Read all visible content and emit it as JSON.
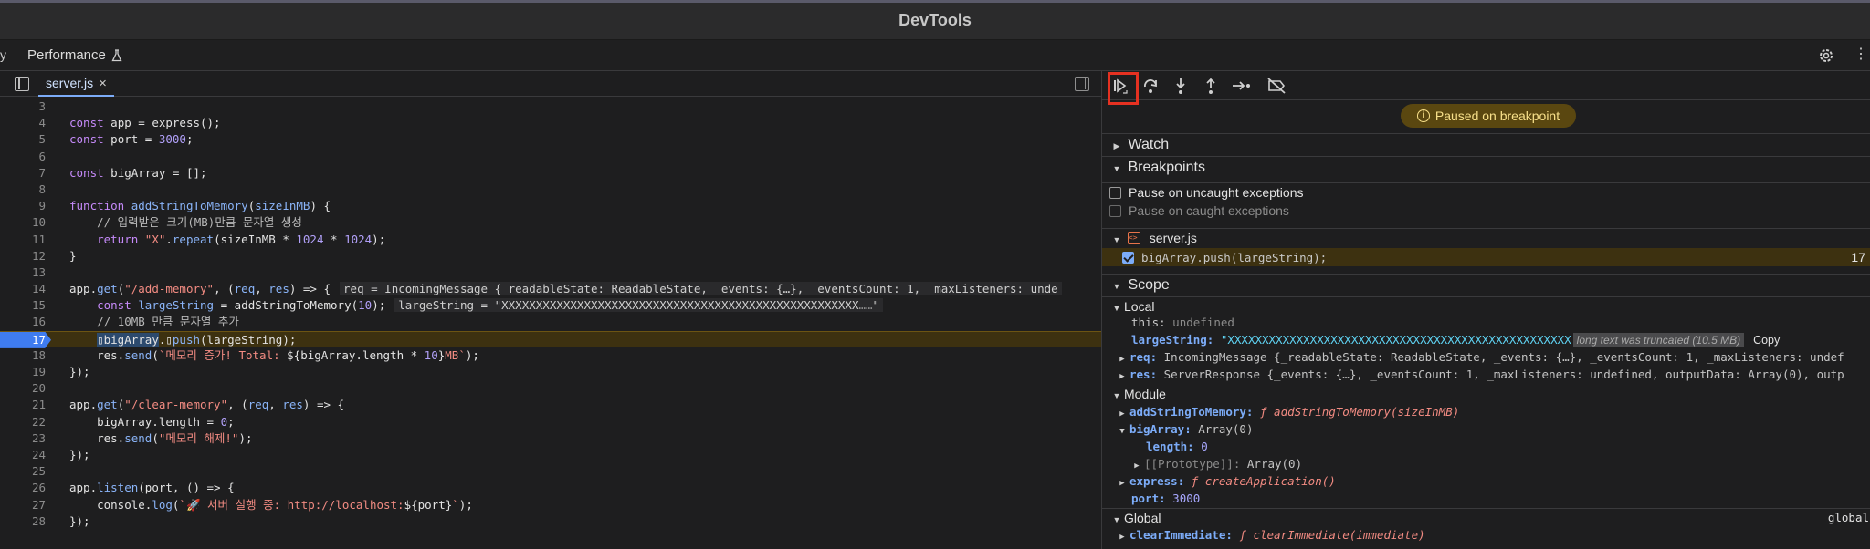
{
  "window": {
    "title": "DevTools"
  },
  "tabs": {
    "stub_label": "y",
    "performance_label": "Performance"
  },
  "editor": {
    "file_tab": "server.js",
    "close_glyph": "×",
    "lines": [
      {
        "n": "3",
        "html": ""
      },
      {
        "n": "4",
        "html": "<span class='kw'>const</span> app = express();"
      },
      {
        "n": "5",
        "html": "<span class='kw'>const</span> port = <span class='num'>3000</span>;"
      },
      {
        "n": "6",
        "html": ""
      },
      {
        "n": "7",
        "html": "<span class='kw'>const</span> bigArray = [];"
      },
      {
        "n": "8",
        "html": ""
      },
      {
        "n": "9",
        "html": "<span class='kw'>function</span> <span class='fn'>addStringToMemory</span>(<span class='fn'>sizeInMB</span>) {"
      },
      {
        "n": "10",
        "html": "    <span class='cm'>// 입력받은 크기(MB)만큼 문자열 생성</span>"
      },
      {
        "n": "11",
        "html": "    <span class='kw'>return</span> <span class='str'>\"X\"</span>.<span class='fn'>repeat</span>(sizeInMB * <span class='num'>1024</span> * <span class='num'>1024</span>);"
      },
      {
        "n": "12",
        "html": "}"
      },
      {
        "n": "13",
        "html": ""
      },
      {
        "n": "14",
        "html": "app.<span class='fn'>get</span>(<span class='str'>\"/add-memory\"</span>, (<span class='fn'>req</span>, <span class='fn'>res</span>) => {<span class='inl'>req = IncomingMessage {_readableState: ReadableState, _events: {…}, _eventsCount: 1, _maxListeners: unde</span>"
      },
      {
        "n": "15",
        "html": "    <span class='kw'>const</span> <span class='fn'>largeString</span> = addStringToMemory(<span class='num'>10</span>);<span class='inl'>largeString = \"XXXXXXXXXXXXXXXXXXXXXXXXXXXXXXXXXXXXXXXXXXXXXXXXXXXX<span class='dim'>……</span>\"</span>"
      },
      {
        "n": "16",
        "html": "    <span class='cm'>// 10MB 만큼 문자열 추가</span>"
      },
      {
        "n": "17",
        "html": "    <span class='hl-sel'>▯bigArray</span>.▯<span class='fn'>push</span>(largeString);",
        "bp": true
      },
      {
        "n": "18",
        "html": "    res.<span class='fn'>send</span>(<span class='str'>`메모리 증가! Total: </span>${bigArray.length * <span class='num'>10</span>}<span class='str'>MB`</span>);"
      },
      {
        "n": "19",
        "html": "});"
      },
      {
        "n": "20",
        "html": ""
      },
      {
        "n": "21",
        "html": "app.<span class='fn'>get</span>(<span class='str'>\"/clear-memory\"</span>, (<span class='fn'>req</span>, <span class='fn'>res</span>) => {"
      },
      {
        "n": "22",
        "html": "    bigArray.length = <span class='num'>0</span>;"
      },
      {
        "n": "23",
        "html": "    res.<span class='fn'>send</span>(<span class='str'>\"메모리 해제!\"</span>);"
      },
      {
        "n": "24",
        "html": "});"
      },
      {
        "n": "25",
        "html": ""
      },
      {
        "n": "26",
        "html": "app.<span class='fn'>listen</span>(port, () => {"
      },
      {
        "n": "27",
        "html": "    console.<span class='fn'>log</span>(<span class='str'>`🚀 서버 실행 중: http://localhost:</span>${port}<span class='str'>`</span>);"
      },
      {
        "n": "28",
        "html": "});"
      }
    ]
  },
  "debugger": {
    "paused_text": "Paused on breakpoint",
    "watch_label": "Watch",
    "breakpoints_label": "Breakpoints",
    "pause_uncaught": "Pause on uncaught exceptions",
    "pause_caught": "Pause on caught exceptions",
    "bp_file": "server.js",
    "bp_code": "bigArray.push(largeString);",
    "bp_line": "17",
    "scope_label": "Scope",
    "local_label": "Local",
    "this_name": "this:",
    "this_value": "undefined",
    "largeString_name": "largeString:",
    "largeString_value": "\"XXXXXXXXXXXXXXXXXXXXXXXXXXXXXXXXXXXXXXXXXXXXXXXXXX",
    "truncated_text": "long text was truncated (10.5 MB)",
    "copy_label": "Copy",
    "req_name": "req:",
    "req_value": "IncomingMessage {_readableState: ReadableState, _events: {…}, _eventsCount: 1, _maxListeners: undef",
    "res_name": "res:",
    "res_value": "ServerResponse {_events: {…}, _eventsCount: 1, _maxListeners: undefined, outputData: Array(0), outp",
    "module_label": "Module",
    "addString_name": "addStringToMemory:",
    "addString_value": "ƒ addStringToMemory(sizeInMB)",
    "bigArray_name": "bigArray:",
    "bigArray_value": "Array(0)",
    "length_name": "length:",
    "length_value": "0",
    "proto_name": "[[Prototype]]:",
    "proto_value": "Array(0)",
    "express_name": "express:",
    "express_value": "ƒ createApplication()",
    "port_name": "port:",
    "port_value": "3000",
    "global_label": "Global",
    "global_right": "global",
    "clearImmediate_name": "clearImmediate:",
    "clearImmediate_value": "ƒ clearImmediate(immediate)"
  },
  "colors": {
    "accent": "#7cacf8",
    "breakpoint": "#3f7cf0",
    "highlight_frame": "#e53121"
  }
}
